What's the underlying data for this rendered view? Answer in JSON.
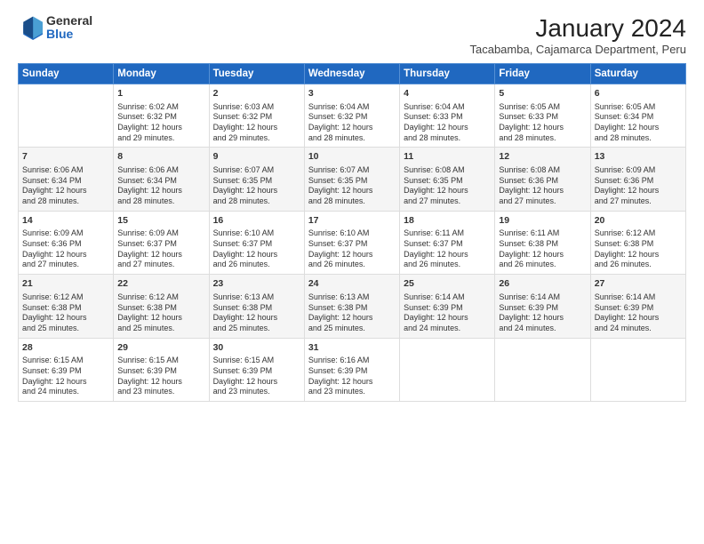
{
  "header": {
    "logo_general": "General",
    "logo_blue": "Blue",
    "title": "January 2024",
    "subtitle": "Tacabamba, Cajamarca Department, Peru"
  },
  "columns": [
    "Sunday",
    "Monday",
    "Tuesday",
    "Wednesday",
    "Thursday",
    "Friday",
    "Saturday"
  ],
  "weeks": [
    [
      {
        "day": "",
        "data": ""
      },
      {
        "day": "1",
        "data": "Sunrise: 6:02 AM\nSunset: 6:32 PM\nDaylight: 12 hours\nand 29 minutes."
      },
      {
        "day": "2",
        "data": "Sunrise: 6:03 AM\nSunset: 6:32 PM\nDaylight: 12 hours\nand 29 minutes."
      },
      {
        "day": "3",
        "data": "Sunrise: 6:04 AM\nSunset: 6:32 PM\nDaylight: 12 hours\nand 28 minutes."
      },
      {
        "day": "4",
        "data": "Sunrise: 6:04 AM\nSunset: 6:33 PM\nDaylight: 12 hours\nand 28 minutes."
      },
      {
        "day": "5",
        "data": "Sunrise: 6:05 AM\nSunset: 6:33 PM\nDaylight: 12 hours\nand 28 minutes."
      },
      {
        "day": "6",
        "data": "Sunrise: 6:05 AM\nSunset: 6:34 PM\nDaylight: 12 hours\nand 28 minutes."
      }
    ],
    [
      {
        "day": "7",
        "data": "Sunrise: 6:06 AM\nSunset: 6:34 PM\nDaylight: 12 hours\nand 28 minutes."
      },
      {
        "day": "8",
        "data": "Sunrise: 6:06 AM\nSunset: 6:34 PM\nDaylight: 12 hours\nand 28 minutes."
      },
      {
        "day": "9",
        "data": "Sunrise: 6:07 AM\nSunset: 6:35 PM\nDaylight: 12 hours\nand 28 minutes."
      },
      {
        "day": "10",
        "data": "Sunrise: 6:07 AM\nSunset: 6:35 PM\nDaylight: 12 hours\nand 28 minutes."
      },
      {
        "day": "11",
        "data": "Sunrise: 6:08 AM\nSunset: 6:35 PM\nDaylight: 12 hours\nand 27 minutes."
      },
      {
        "day": "12",
        "data": "Sunrise: 6:08 AM\nSunset: 6:36 PM\nDaylight: 12 hours\nand 27 minutes."
      },
      {
        "day": "13",
        "data": "Sunrise: 6:09 AM\nSunset: 6:36 PM\nDaylight: 12 hours\nand 27 minutes."
      }
    ],
    [
      {
        "day": "14",
        "data": "Sunrise: 6:09 AM\nSunset: 6:36 PM\nDaylight: 12 hours\nand 27 minutes."
      },
      {
        "day": "15",
        "data": "Sunrise: 6:09 AM\nSunset: 6:37 PM\nDaylight: 12 hours\nand 27 minutes."
      },
      {
        "day": "16",
        "data": "Sunrise: 6:10 AM\nSunset: 6:37 PM\nDaylight: 12 hours\nand 26 minutes."
      },
      {
        "day": "17",
        "data": "Sunrise: 6:10 AM\nSunset: 6:37 PM\nDaylight: 12 hours\nand 26 minutes."
      },
      {
        "day": "18",
        "data": "Sunrise: 6:11 AM\nSunset: 6:37 PM\nDaylight: 12 hours\nand 26 minutes."
      },
      {
        "day": "19",
        "data": "Sunrise: 6:11 AM\nSunset: 6:38 PM\nDaylight: 12 hours\nand 26 minutes."
      },
      {
        "day": "20",
        "data": "Sunrise: 6:12 AM\nSunset: 6:38 PM\nDaylight: 12 hours\nand 26 minutes."
      }
    ],
    [
      {
        "day": "21",
        "data": "Sunrise: 6:12 AM\nSunset: 6:38 PM\nDaylight: 12 hours\nand 25 minutes."
      },
      {
        "day": "22",
        "data": "Sunrise: 6:12 AM\nSunset: 6:38 PM\nDaylight: 12 hours\nand 25 minutes."
      },
      {
        "day": "23",
        "data": "Sunrise: 6:13 AM\nSunset: 6:38 PM\nDaylight: 12 hours\nand 25 minutes."
      },
      {
        "day": "24",
        "data": "Sunrise: 6:13 AM\nSunset: 6:38 PM\nDaylight: 12 hours\nand 25 minutes."
      },
      {
        "day": "25",
        "data": "Sunrise: 6:14 AM\nSunset: 6:39 PM\nDaylight: 12 hours\nand 24 minutes."
      },
      {
        "day": "26",
        "data": "Sunrise: 6:14 AM\nSunset: 6:39 PM\nDaylight: 12 hours\nand 24 minutes."
      },
      {
        "day": "27",
        "data": "Sunrise: 6:14 AM\nSunset: 6:39 PM\nDaylight: 12 hours\nand 24 minutes."
      }
    ],
    [
      {
        "day": "28",
        "data": "Sunrise: 6:15 AM\nSunset: 6:39 PM\nDaylight: 12 hours\nand 24 minutes."
      },
      {
        "day": "29",
        "data": "Sunrise: 6:15 AM\nSunset: 6:39 PM\nDaylight: 12 hours\nand 23 minutes."
      },
      {
        "day": "30",
        "data": "Sunrise: 6:15 AM\nSunset: 6:39 PM\nDaylight: 12 hours\nand 23 minutes."
      },
      {
        "day": "31",
        "data": "Sunrise: 6:16 AM\nSunset: 6:39 PM\nDaylight: 12 hours\nand 23 minutes."
      },
      {
        "day": "",
        "data": ""
      },
      {
        "day": "",
        "data": ""
      },
      {
        "day": "",
        "data": ""
      }
    ]
  ]
}
